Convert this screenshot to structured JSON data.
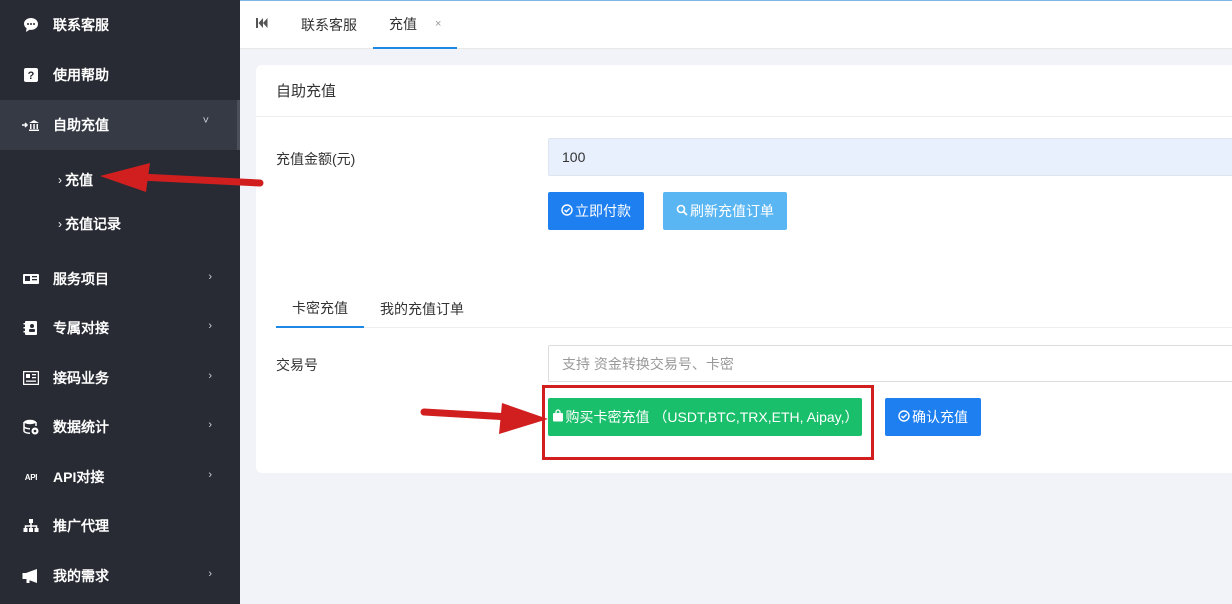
{
  "sidebar": {
    "items": [
      {
        "label": "联系客服",
        "icon": "chat-bubble-icon"
      },
      {
        "label": "使用帮助",
        "icon": "help-icon"
      },
      {
        "label": "自助充值",
        "icon": "bank-transfer-icon",
        "expanded": true
      },
      {
        "label": "服务项目",
        "icon": "id-card-icon"
      },
      {
        "label": "专属对接",
        "icon": "phone-book-icon"
      },
      {
        "label": "接码业务",
        "icon": "news-icon"
      },
      {
        "label": "数据统计",
        "icon": "database-icon"
      },
      {
        "label": "API对接",
        "icon": "api-icon",
        "icon_text": "API"
      },
      {
        "label": "推广代理",
        "icon": "org-chart-icon"
      },
      {
        "label": "我的需求",
        "icon": "megaphone-icon"
      }
    ],
    "subitems": [
      {
        "label": "充值",
        "active": true
      },
      {
        "label": "充值记录"
      }
    ]
  },
  "tabs": {
    "items": [
      {
        "label": "联系客服"
      },
      {
        "label": "充值",
        "active": true,
        "closable": true
      }
    ],
    "close_glyph": "×"
  },
  "card": {
    "title": "自助充值",
    "amount_label": "充值金额(元)",
    "amount_value": "100",
    "pay_button": "立即付款",
    "refresh_button": "刷新充值订单",
    "subtabs": [
      "卡密充值",
      "我的充值订单"
    ],
    "tx_label": "交易号",
    "tx_placeholder": "支持 资金转换交易号、卡密",
    "buy_button": "购买卡密充值 （USDT,BTC,TRX,ETH, Aipay,）",
    "confirm_button": "确认充值"
  },
  "colors": {
    "sidebar_bg": "#282b33",
    "primary": "#1e7ff0",
    "light_primary": "#5ab6f2",
    "success": "#19bf6a",
    "annotation_red": "#d11f1f"
  }
}
